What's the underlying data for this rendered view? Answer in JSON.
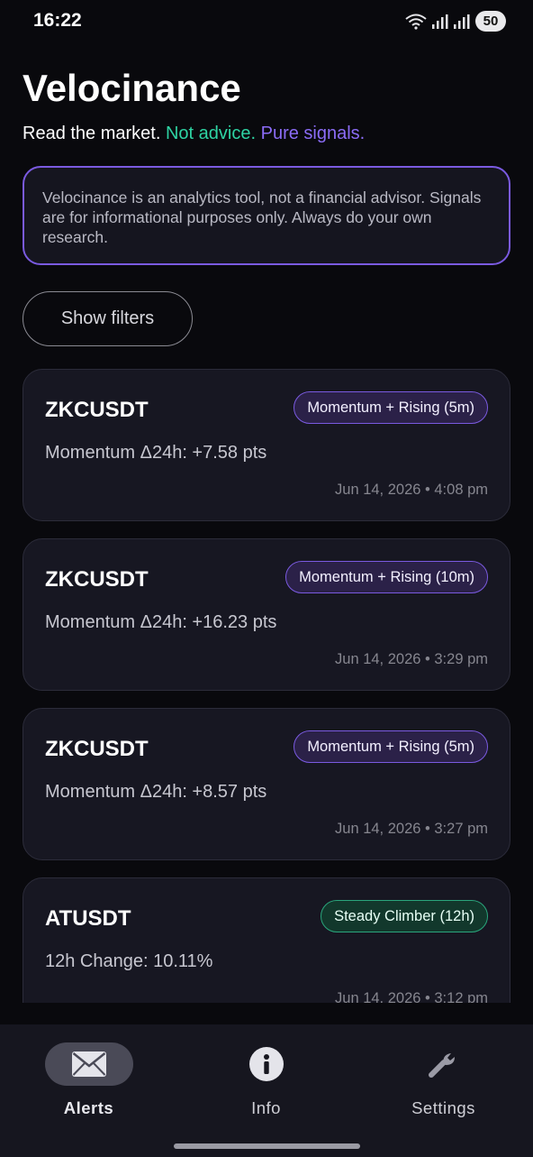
{
  "status_bar": {
    "time": "16:22",
    "battery": "50"
  },
  "header": {
    "title": "Velocinance",
    "tagline_prefix": "Read the market.",
    "tagline_green": "Not advice.",
    "tagline_purple": "Pure signals."
  },
  "disclaimer": "Velocinance is an analytics tool, not a financial advisor. Signals are for informational purposes only. Always do your own research.",
  "filters_button": "Show filters",
  "alerts": [
    {
      "symbol": "ZKCUSDT",
      "badge": "Momentum + Rising (5m)",
      "badge_color": "#7a5ae0",
      "metric": "Momentum Δ24h: +7.58 pts",
      "time": "Jun 14, 2026 • 4:08 pm"
    },
    {
      "symbol": "ZKCUSDT",
      "badge": "Momentum + Rising (10m)",
      "badge_color": "#7a5ae0",
      "metric": "Momentum Δ24h: +16.23 pts",
      "time": "Jun 14, 2026 • 3:29 pm"
    },
    {
      "symbol": "ZKCUSDT",
      "badge": "Momentum + Rising (5m)",
      "badge_color": "#7a5ae0",
      "metric": "Momentum Δ24h: +8.57 pts",
      "time": "Jun 14, 2026 • 3:27 pm"
    },
    {
      "symbol": "ATUSDT",
      "badge": "Steady Climber (12h)",
      "badge_color": "#2aa57c",
      "metric": "12h Change: 10.11%",
      "time": "Jun 14, 2026 • 3:12 pm"
    }
  ],
  "nav": {
    "items": [
      {
        "label": "Alerts",
        "icon": "envelope-icon",
        "active": true
      },
      {
        "label": "Info",
        "icon": "info-icon",
        "active": false
      },
      {
        "label": "Settings",
        "icon": "wrench-icon",
        "active": false
      }
    ]
  },
  "colors": {
    "background": "#09090d",
    "accent_purple": "#7a5ae0",
    "accent_green": "#2ed3a3",
    "card": "#171722"
  }
}
